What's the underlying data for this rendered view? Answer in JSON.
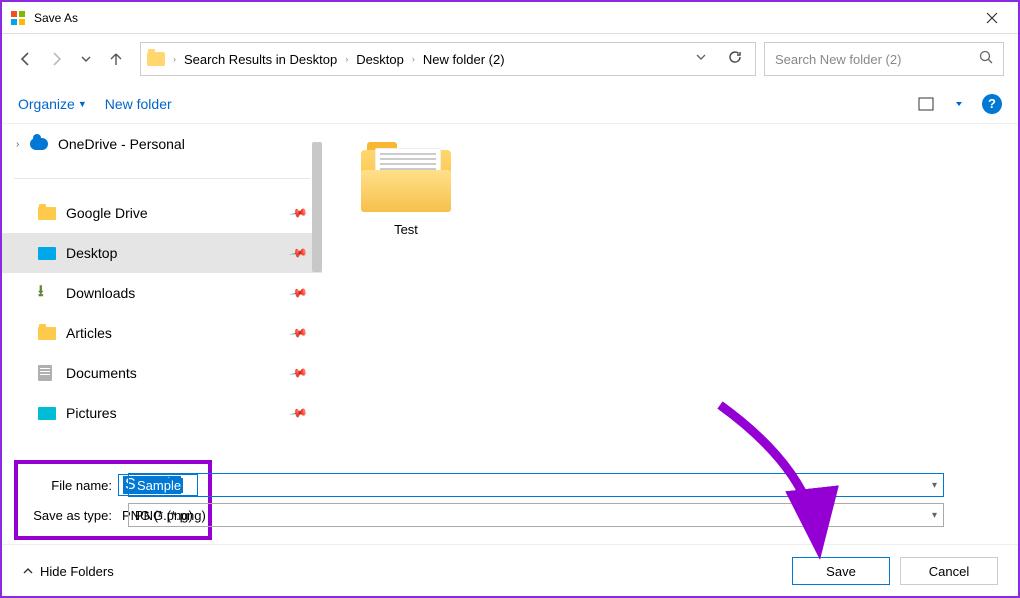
{
  "window": {
    "title": "Save As"
  },
  "breadcrumb": {
    "items": [
      "Search Results in Desktop",
      "Desktop",
      "New folder (2)"
    ]
  },
  "search": {
    "placeholder": "Search New folder (2)"
  },
  "toolbar": {
    "organize": "Organize",
    "newfolder": "New folder"
  },
  "tree": {
    "onedrive": "OneDrive - Personal",
    "gdrive": "Google Drive",
    "desktop": "Desktop",
    "downloads": "Downloads",
    "articles": "Articles",
    "documents": "Documents",
    "pictures": "Pictures"
  },
  "content": {
    "items": [
      {
        "label": "Test"
      }
    ]
  },
  "form": {
    "filename_label": "File name:",
    "filename_value": "Sample",
    "type_label": "Save as type:",
    "type_value": "PNG (*.png)"
  },
  "footer": {
    "hide": "Hide Folders",
    "save": "Save",
    "cancel": "Cancel"
  }
}
